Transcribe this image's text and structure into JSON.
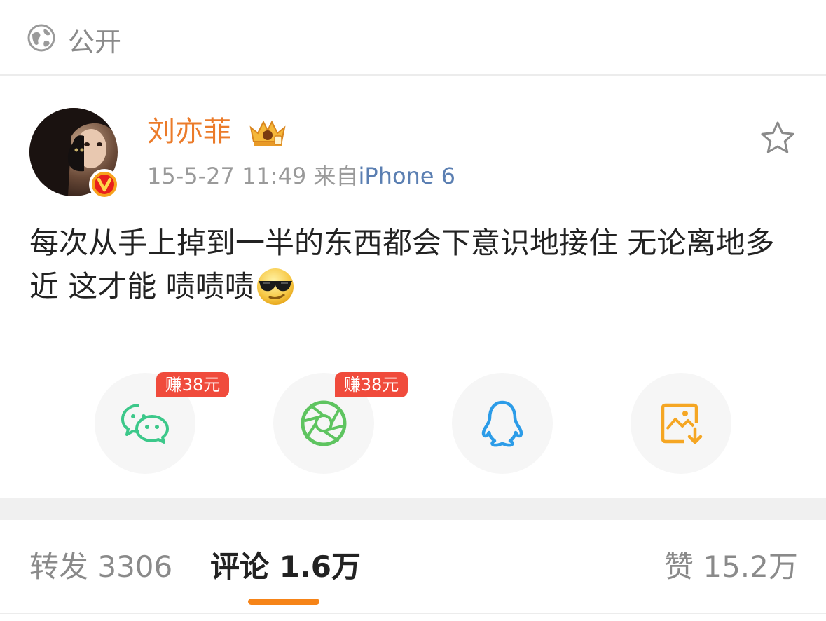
{
  "visibility": {
    "label": "公开",
    "icon": "globe-icon"
  },
  "post": {
    "author": "刘亦菲",
    "timestamp": "15-5-27 11:49",
    "source_prefix": "来自",
    "source": "iPhone 6",
    "text": "每次从手上掉到一半的东西都会下意识地接住 无论离地多近 这才能 啧啧啧",
    "emoji": "cool-sunglasses-emoji",
    "badge": "verified-v-icon",
    "member_icon": "crown-icon"
  },
  "share": {
    "items": [
      {
        "name": "wechat",
        "icon": "wechat-icon",
        "reward": "赚38元",
        "color": "#3cc88a"
      },
      {
        "name": "moments",
        "icon": "moments-aperture-icon",
        "reward": "赚38元",
        "color": "#5ec460"
      },
      {
        "name": "qq",
        "icon": "qq-penguin-icon",
        "color": "#2c9ce8"
      },
      {
        "name": "save-image",
        "icon": "save-image-icon",
        "color": "#f5a623"
      }
    ]
  },
  "tabs": {
    "repost": "转发 3306",
    "comments": "评论 1.6万",
    "likes": "赞 15.2万"
  },
  "colors": {
    "username": "#eb7b2a",
    "source_link": "#5b7fb2",
    "reward_bg": "#f04b3c",
    "active_tab_indicator": "#f68418"
  }
}
